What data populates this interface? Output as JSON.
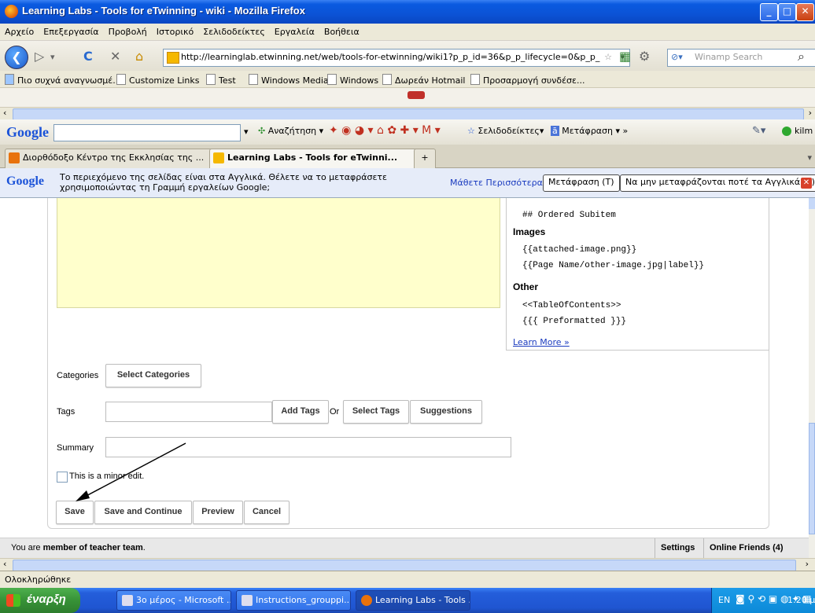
{
  "window": {
    "title": "Learning Labs - Tools for eTwinning - wiki - Mozilla Firefox"
  },
  "menu": [
    "Αρχείο",
    "Επεξεργασία",
    "Προβολή",
    "Ιστορικό",
    "Σελιδοδείκτες",
    "Εργαλεία",
    "Βοήθεια"
  ],
  "nav": {
    "url": "http://learninglab.etwinning.net/web/tools-for-etwinning/wiki1?p_p_id=36&p_p_lifecycle=0&p_p_",
    "search_placeholder": "Winamp Search"
  },
  "bookmarks": [
    "Πιο συχνά αναγνωσμέ...",
    "Customize Links",
    "Test",
    "Windows Media",
    "Windows",
    "Δωρεάν Hotmail",
    "Προσαρμογή συνδέσε..."
  ],
  "google_toolbar": {
    "logo": "Google",
    "search_label": "Αναζήτηση",
    "bookmarks_label": "Σελιδοδείκτες",
    "translate_label": "Μετάφραση",
    "more": "»",
    "user": "kilm"
  },
  "tabs": [
    {
      "label": "Διορθόδοξο Κέντρο της Εκκλησίας της ...",
      "active": false
    },
    {
      "label": "Learning Labs - Tools for eTwinni...",
      "active": true
    }
  ],
  "translate_bar": {
    "logo": "Google",
    "message": "Το περιεχόμενο της σελίδας είναι στα Αγγλικά. Θέλετε να το μεταφράσετε χρησιμοποιώντας τη Γραμμή εργαλείων Google;",
    "learn_more": "Μάθετε Περισσότερα",
    "translate_button": "Μετάφραση (T)",
    "never_button": "Να μην μεταφράζονται ποτέ τα Αγγλικά (T)"
  },
  "help": {
    "ordered_subitem": "## Ordered Subitem",
    "images_heading": "Images",
    "img1": "{{attached-image.png}}",
    "img2": "{{Page Name/other-image.jpg|label}}",
    "other_heading": "Other",
    "toc": "<<TableOfContents>>",
    "pre": "{{{ Preformatted }}}",
    "learn_more": "Learn More »"
  },
  "form": {
    "categories_label": "Categories",
    "select_categories": "Select Categories",
    "tags_label": "Tags",
    "add_tags": "Add Tags",
    "or": "Or",
    "select_tags": "Select Tags",
    "suggestions": "Suggestions",
    "summary_label": "Summary",
    "minor_edit": "This is a minor edit.",
    "save": "Save",
    "save_continue": "Save and Continue",
    "preview": "Preview",
    "cancel": "Cancel"
  },
  "teambar": {
    "prefix": "You are ",
    "team": "member of teacher team",
    "suffix": ".",
    "settings": "Settings",
    "friends": "Online Friends (4)"
  },
  "status": "Ολοκληρώθηκε",
  "taskbar": {
    "start": "έναρξη",
    "tasks": [
      "3ο μέρος - Microsoft ...",
      "Instructions_grouppi...",
      "Learning Labs - Tools ..."
    ],
    "lang": "EN",
    "time": "1:20 μμ"
  }
}
